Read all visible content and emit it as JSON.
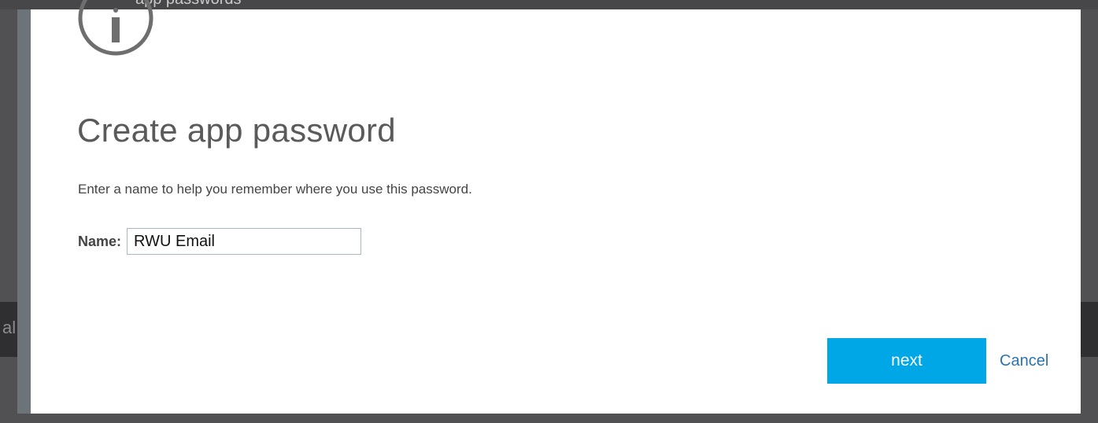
{
  "window": {
    "title_partial": "app passwords",
    "background_partial_glyph": "al"
  },
  "dialog": {
    "icon": "info-circle-icon",
    "title": "Create app password",
    "description": "Enter a name to help you remember where you use this password.",
    "name_field": {
      "label": "Name:",
      "value": "RWU Email"
    },
    "next_label": "next",
    "cancel_label": "Cancel"
  },
  "colors": {
    "accent": "#00a7e6",
    "link": "#2b73b3",
    "overlay": "#515153",
    "sidebar_accent": "#6d7479"
  }
}
